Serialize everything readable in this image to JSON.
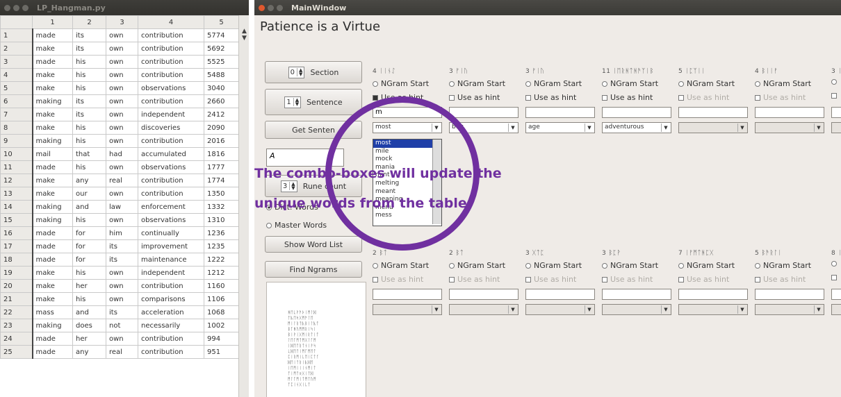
{
  "left_window": {
    "title": "LP_Hangman.py",
    "column_headers": [
      "1",
      "2",
      "3",
      "4",
      "5"
    ],
    "rows": [
      [
        "1",
        "made",
        "its",
        "own",
        "contribution",
        "5774"
      ],
      [
        "2",
        "make",
        "its",
        "own",
        "contribution",
        "5692"
      ],
      [
        "3",
        "made",
        "his",
        "own",
        "contribution",
        "5525"
      ],
      [
        "4",
        "make",
        "his",
        "own",
        "contribution",
        "5488"
      ],
      [
        "5",
        "make",
        "his",
        "own",
        "observations",
        "3040"
      ],
      [
        "6",
        "making",
        "its",
        "own",
        "contribution",
        "2660"
      ],
      [
        "7",
        "make",
        "its",
        "own",
        "independent",
        "2412"
      ],
      [
        "8",
        "make",
        "his",
        "own",
        "discoveries",
        "2090"
      ],
      [
        "9",
        "making",
        "his",
        "own",
        "contribution",
        "2016"
      ],
      [
        "10",
        "mail",
        "that",
        "had",
        "accumulated",
        "1816"
      ],
      [
        "11",
        "made",
        "his",
        "own",
        "observations",
        "1777"
      ],
      [
        "12",
        "make",
        "any",
        "real",
        "contribution",
        "1774"
      ],
      [
        "13",
        "make",
        "our",
        "own",
        "contribution",
        "1350"
      ],
      [
        "14",
        "making",
        "and",
        "law",
        "enforcement",
        "1332"
      ],
      [
        "15",
        "making",
        "his",
        "own",
        "observations",
        "1310"
      ],
      [
        "16",
        "made",
        "for",
        "him",
        "continually",
        "1236"
      ],
      [
        "17",
        "made",
        "for",
        "its",
        "improvement",
        "1235"
      ],
      [
        "18",
        "made",
        "for",
        "its",
        "maintenance",
        "1222"
      ],
      [
        "19",
        "make",
        "his",
        "own",
        "independent",
        "1212"
      ],
      [
        "20",
        "make",
        "her",
        "own",
        "contribution",
        "1160"
      ],
      [
        "21",
        "make",
        "his",
        "own",
        "comparisons",
        "1106"
      ],
      [
        "22",
        "mass",
        "and",
        "its",
        "acceleration",
        "1068"
      ],
      [
        "23",
        "making",
        "does",
        "not",
        "necessarily",
        "1002"
      ],
      [
        "24",
        "made",
        "her",
        "own",
        "contribution",
        "994"
      ],
      [
        "25",
        "made",
        "any",
        "real",
        "contribution",
        "951"
      ]
    ]
  },
  "main_window": {
    "title": "MainWindow",
    "heading": "Patience is a Virtue",
    "section_value": "0",
    "section_label": "Section",
    "sentence_value": "1",
    "sentence_label": "Sentence",
    "get_sentence_label": "Get Senten",
    "text_value": "A",
    "rune_value": "3",
    "rune_label": "Rune count",
    "radio_dict": "Dict. Words",
    "radio_master": "Master Words",
    "show_word_list": "Show Word List",
    "find_ngrams": "Find Ngrams",
    "rune_glyphs": "ᚻᛖᚳᚹᚫᚦᛁᛗᛚᛞ\nᛏᚣᛖᛋᚷᛗᚫᛚᛖ\nᛗᛁᛚᚱᛏᚣᛒᛁᛚᚣᛏ\nᛒᚪᚻᚢᛗᛗᚱᛁᛋᛁ\nᛒᛁᚹᛁᚷᛗᛁᚱᛏᛁᛏ\nᛚᛖᚪᛗᛏᛗᚷᛚᚪᛗ\nᛁᛞᛖᛏᚱᛏᚾᛁᚹᛋ\nᚳᛞᛖᛏᛁᛗᚪᛗᛖᛏ\nᛈᛁᚱᛗᛁᚳᛖᛁᛈᛏᚴ\nᛞᛖᛁᛏᚱᛁᚣᛞᛖ\nᛁᛖᛗᛁᛁᛁᚾᛗᛁᛏ\nᚩᛁᛗᛏᛟᚷᛁᛏᛞ\nᛗᛚᚪᛗᛁᛏᛗᛏᚢᛗ\nᚩᛈᛁᚾᚷᛁᚳᛏ"
  },
  "columns_top": [
    {
      "header": "4 ᛁᛁᚾᛇ",
      "ngram": "NGram Start",
      "hint": "Use as hint",
      "hint_on": true,
      "input": "m",
      "combo": "most",
      "active": true
    },
    {
      "header": "3 ᚠᛁᚢ",
      "ngram": "NGram Start",
      "hint": "Use as hint",
      "hint_on": false,
      "input": "",
      "combo": "buy",
      "active": true
    },
    {
      "header": "3 ᚠᛁᚢ",
      "ngram": "NGram Start",
      "hint": "Use as hint",
      "hint_on": false,
      "input": "",
      "combo": "age",
      "active": true
    },
    {
      "header": "11 ᛁᛖᚱᚻᛏᚻᚫᛉᛁᛒ",
      "ngram": "NGram Start",
      "hint": "Use as hint",
      "hint_on": false,
      "input": "",
      "combo": "adventurous",
      "active": true
    },
    {
      "header": "5 ᛁᛈᛉᛁᛁ",
      "ngram": "NGram Start",
      "hint": "Use as hint",
      "hint_on": false,
      "input": "",
      "combo": "",
      "active": false
    },
    {
      "header": "4 ᛒᛁᛁᚠ",
      "ngram": "NGram Start",
      "hint": "Use as hint",
      "hint_on": false,
      "input": "",
      "combo": "",
      "active": false
    },
    {
      "header": "3 ᛁ",
      "ngram": "",
      "hint": "",
      "hint_on": false,
      "input": "",
      "combo": "",
      "active": false
    }
  ],
  "columns_bottom": [
    {
      "header": "2 ᛒᛏ",
      "ngram": "NGram Start",
      "hint": "Use as hint"
    },
    {
      "header": "2 ᛒᛏ",
      "ngram": "NGram Start",
      "hint": "Use as hint"
    },
    {
      "header": "3 ᚷᛏᛈ",
      "ngram": "NGram Start",
      "hint": "Use as hint"
    },
    {
      "header": "3 ᛒᛈᚹ",
      "ngram": "NGram Start",
      "hint": "Use as hint"
    },
    {
      "header": "7 ᛁᚠᛗᛏᚻᛈᚷ",
      "ngram": "NGram Start",
      "hint": "Use as hint"
    },
    {
      "header": "5 ᛒᚫᚱᛚᛁ",
      "ngram": "NGram Start",
      "hint": "Use as hint"
    },
    {
      "header": "8 ᛁ",
      "ngram": "",
      "hint": ""
    }
  ],
  "dropdown_options": [
    "most",
    "mile",
    "mock",
    "mania",
    "mint",
    "melting",
    "meant",
    "meaning",
    "menu",
    "mess"
  ],
  "annotation": {
    "line1": "The combo-boxes will update the",
    "line2": "unique words from the table.",
    "color": "#7030a0"
  }
}
